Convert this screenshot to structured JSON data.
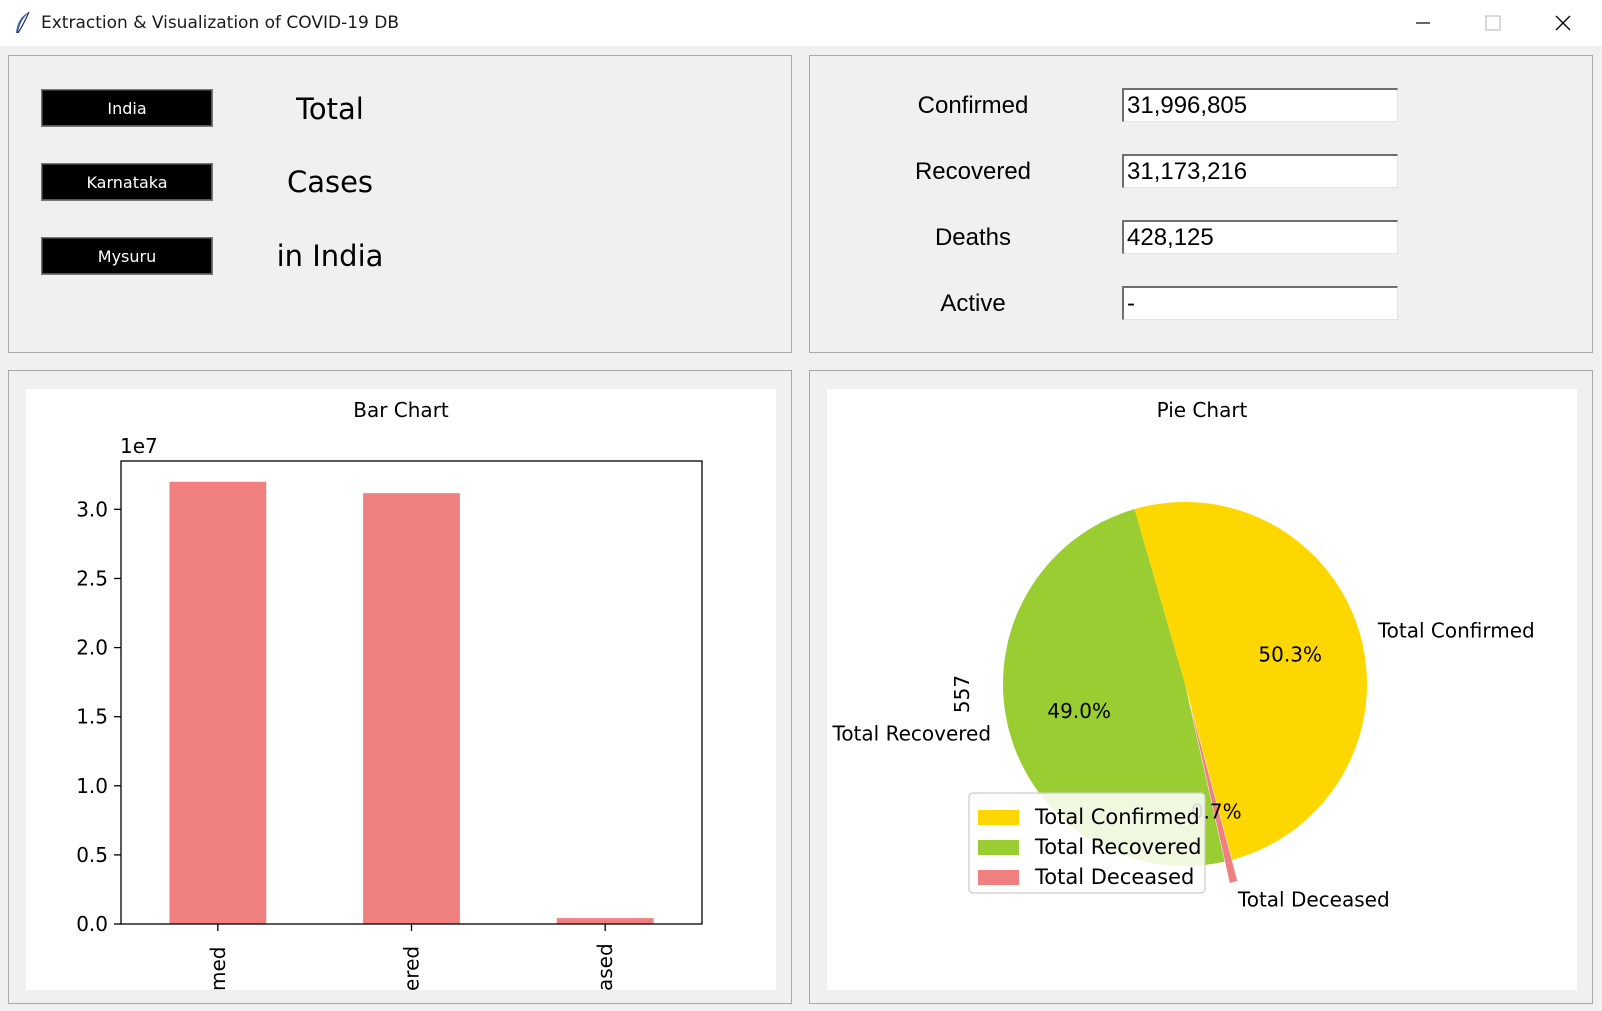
{
  "window": {
    "title": "Extraction & Visualization of COVID-19 DB",
    "icon": "feather-icon"
  },
  "regions": [
    "India",
    "Karnataka",
    "Mysuru"
  ],
  "heading": [
    "Total",
    "Cases",
    "in India"
  ],
  "stats": {
    "confirmed": {
      "label": "Confirmed",
      "value": "31,996,805"
    },
    "recovered": {
      "label": "Recovered",
      "value": "31,173,216"
    },
    "deaths": {
      "label": "Deaths",
      "value": "428,125"
    },
    "active": {
      "label": "Active",
      "value": "-"
    }
  },
  "colors": {
    "bar": "#f08080",
    "confirmed": "#ffd700",
    "recovered": "#9acd32",
    "deceased": "#f08080"
  },
  "chart_data": [
    {
      "type": "bar",
      "title": "Bar Chart",
      "categories": [
        "Total Confirmed",
        "Total Recovered",
        "Total Deceased"
      ],
      "tick_labels": [
        "med",
        "ered",
        "ased"
      ],
      "values": [
        31996805,
        31173216,
        428125
      ],
      "offset_label": "1e7",
      "yticks": [
        "0.0",
        "0.5",
        "1.0",
        "1.5",
        "2.0",
        "2.5",
        "3.0"
      ],
      "ylim": [
        0,
        33500000
      ]
    },
    {
      "type": "pie",
      "title": "Pie Chart",
      "ylabel": "557",
      "labels": [
        "Total Confirmed",
        "Total Recovered",
        "Total Deceased"
      ],
      "values": [
        31996805,
        31173216,
        428125
      ],
      "pct_labels": [
        "50.3%",
        "49.0%",
        "0.7%"
      ],
      "legend": [
        "Total Confirmed",
        "Total Recovered",
        "Total Deceased"
      ],
      "legend_position": "lower-left"
    }
  ]
}
